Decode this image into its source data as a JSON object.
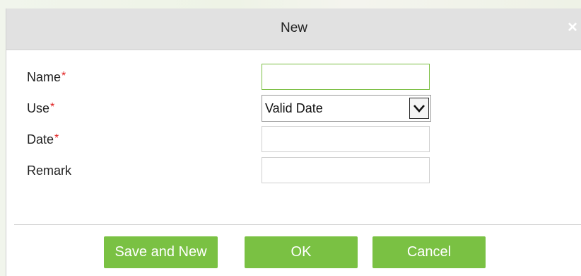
{
  "dialog": {
    "title": "New",
    "close_symbol": "×"
  },
  "form": {
    "name": {
      "label": "Name",
      "required_mark": "*",
      "value": ""
    },
    "use": {
      "label": "Use",
      "required_mark": "*",
      "selected": "Valid Date"
    },
    "date": {
      "label": "Date",
      "required_mark": "*",
      "value": ""
    },
    "remark": {
      "label": "Remark",
      "value": ""
    }
  },
  "buttons": {
    "save_and_new": "Save and New",
    "ok": "OK",
    "cancel": "Cancel"
  },
  "colors": {
    "accent_green": "#7ac143",
    "required_red": "#e02020",
    "titlebar_gray": "#e1e1e1"
  },
  "icons": {
    "close": "close-icon",
    "dropdown": "chevron-down-icon"
  }
}
